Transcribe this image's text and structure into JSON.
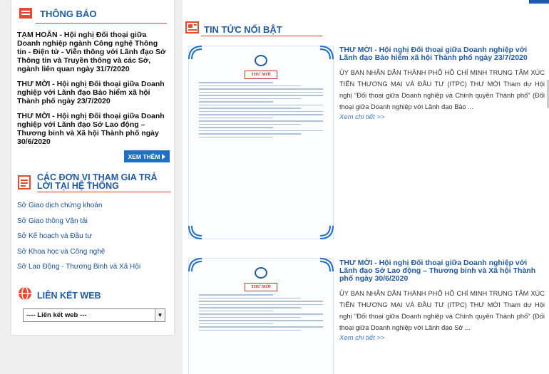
{
  "sidebar": {
    "notices_title": "THÔNG BÁO",
    "notices": [
      "TẠM HOÃN - Hội nghị Đối thoại giữa Doanh nghiệp ngành Công nghệ Thông tin - Điện tử - Viễn thông với Lãnh đạo Sở Thông tin và Truyền thông và các Sở, ngành liên quan ngày 31/7/2020",
      "THƯ MỜI - Hội nghị Đối thoại giữa Doanh nghiệp với Lãnh đạo Bảo hiểm xã hội Thành phố ngày 23/7/2020",
      "THƯ MỜI - Hội nghị Đối thoại giữa Doanh nghiệp với Lãnh đạo Sở Lao động – Thương binh và Xã hội Thành phố ngày 30/6/2020"
    ],
    "more_label": "XEM THÊM",
    "units_title": "CÁC ĐƠN VỊ THAM GIA TRẢ LỜI TẠI HỆ THỐNG",
    "units": [
      "Sở Giao dịch chứng khoán",
      "Sở Giao thông Vận tải",
      "Sở Kế hoạch và Đầu tư",
      "Sở Khoa học và Công nghệ",
      "Sở Lao Động - Thương Binh và Xã Hội"
    ],
    "links_title": "LIÊN KẾT WEB",
    "links_select": "---- Liên kết web ---"
  },
  "main": {
    "news_title": "TIN TỨC NỔI BẬT",
    "items": [
      {
        "title": "THƯ MỜI - Hội nghị Đối thoại giữa Doanh nghiệp với Lãnh đạo Bảo hiểm xã hội Thành phố ngày 23/7/2020",
        "desc": "ỦY BAN NHÂN DÂN THÀNH PHỐ HỒ CHÍ MINH TRUNG TÂM XÚC TIẾN THƯƠNG MẠI VÀ ĐẦU TƯ (ITPC)   THƯ MỜI Tham dự Hội nghị \"Đối thoại giữa Doanh nghiệp và Chính quyền Thành phố\" (Đối thoại giữa Doanh nghiệp với Lãnh đạo Bảo ...",
        "more": "Xem chi tiết >>",
        "doc_stamp": "THƯ MỜI"
      },
      {
        "title": "THƯ MỜI - Hội nghị Đối thoại giữa Doanh nghiệp với Lãnh đạo Sở Lao động – Thương binh và Xã hội Thành phố ngày 30/6/2020",
        "desc": "ỦY BAN NHÂN DÂN THÀNH PHỐ HỒ CHÍ MINH TRUNG TÂM XÚC TIẾN THƯƠNG MẠI VÀ ĐẦU TƯ (ITPC)   THƯ MỜI Tham dự Hội nghị \"Đối thoại giữa Doanh nghiệp và Chính quyền Thành phố\" (Đối thoại giữa Doanh nghiệp với Lãnh đạo Sở ...",
        "more": "Xem chi tiết >>",
        "doc_stamp": "THƯ MỜI"
      }
    ]
  },
  "colors": {
    "accent_blue": "#1f5aa6",
    "accent_red": "#dc3b2b",
    "button_blue": "#1f6fc5"
  }
}
